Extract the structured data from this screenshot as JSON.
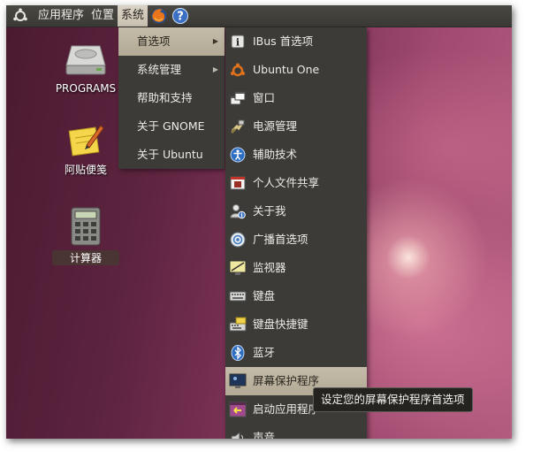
{
  "topbar": {
    "applications": "应用程序",
    "places": "位置",
    "system": "系统"
  },
  "desktop": {
    "icons": [
      {
        "label": "PROGRAMS",
        "icon": "hard-drive-icon"
      },
      {
        "label": "阿贴便笺",
        "icon": "notepad-icon"
      },
      {
        "label": "计算器",
        "icon": "calculator-icon"
      }
    ]
  },
  "system_menu": {
    "items": [
      {
        "label": "首选项",
        "has_submenu": true,
        "active": true
      },
      {
        "label": "系统管理",
        "has_submenu": true
      },
      {
        "label": "帮助和支持"
      },
      {
        "label": "关于 GNOME"
      },
      {
        "label": "关于 Ubuntu"
      }
    ]
  },
  "preferences_menu": {
    "items": [
      {
        "label": "IBus 首选项",
        "icon": "info-icon"
      },
      {
        "label": "Ubuntu One",
        "icon": "ubuntu-one-icon"
      },
      {
        "label": "窗口",
        "icon": "windows-icon"
      },
      {
        "label": "电源管理",
        "icon": "power-icon"
      },
      {
        "label": "辅助技术",
        "icon": "accessibility-icon"
      },
      {
        "label": "个人文件共享",
        "icon": "file-share-icon"
      },
      {
        "label": "关于我",
        "icon": "about-me-icon"
      },
      {
        "label": "广播首选项",
        "icon": "broadcast-icon"
      },
      {
        "label": "监视器",
        "icon": "monitor-icon"
      },
      {
        "label": "键盘",
        "icon": "keyboard-icon"
      },
      {
        "label": "键盘快捷键",
        "icon": "keyboard-shortcut-icon"
      },
      {
        "label": "蓝牙",
        "icon": "bluetooth-icon"
      },
      {
        "label": "屏幕保护程序",
        "icon": "screensaver-icon",
        "active": true
      },
      {
        "label": "启动应用程序",
        "icon": "startup-icon"
      },
      {
        "label": "声音",
        "icon": "sound-icon"
      }
    ]
  },
  "tooltip": "设定您的屏幕保护程序首选项"
}
